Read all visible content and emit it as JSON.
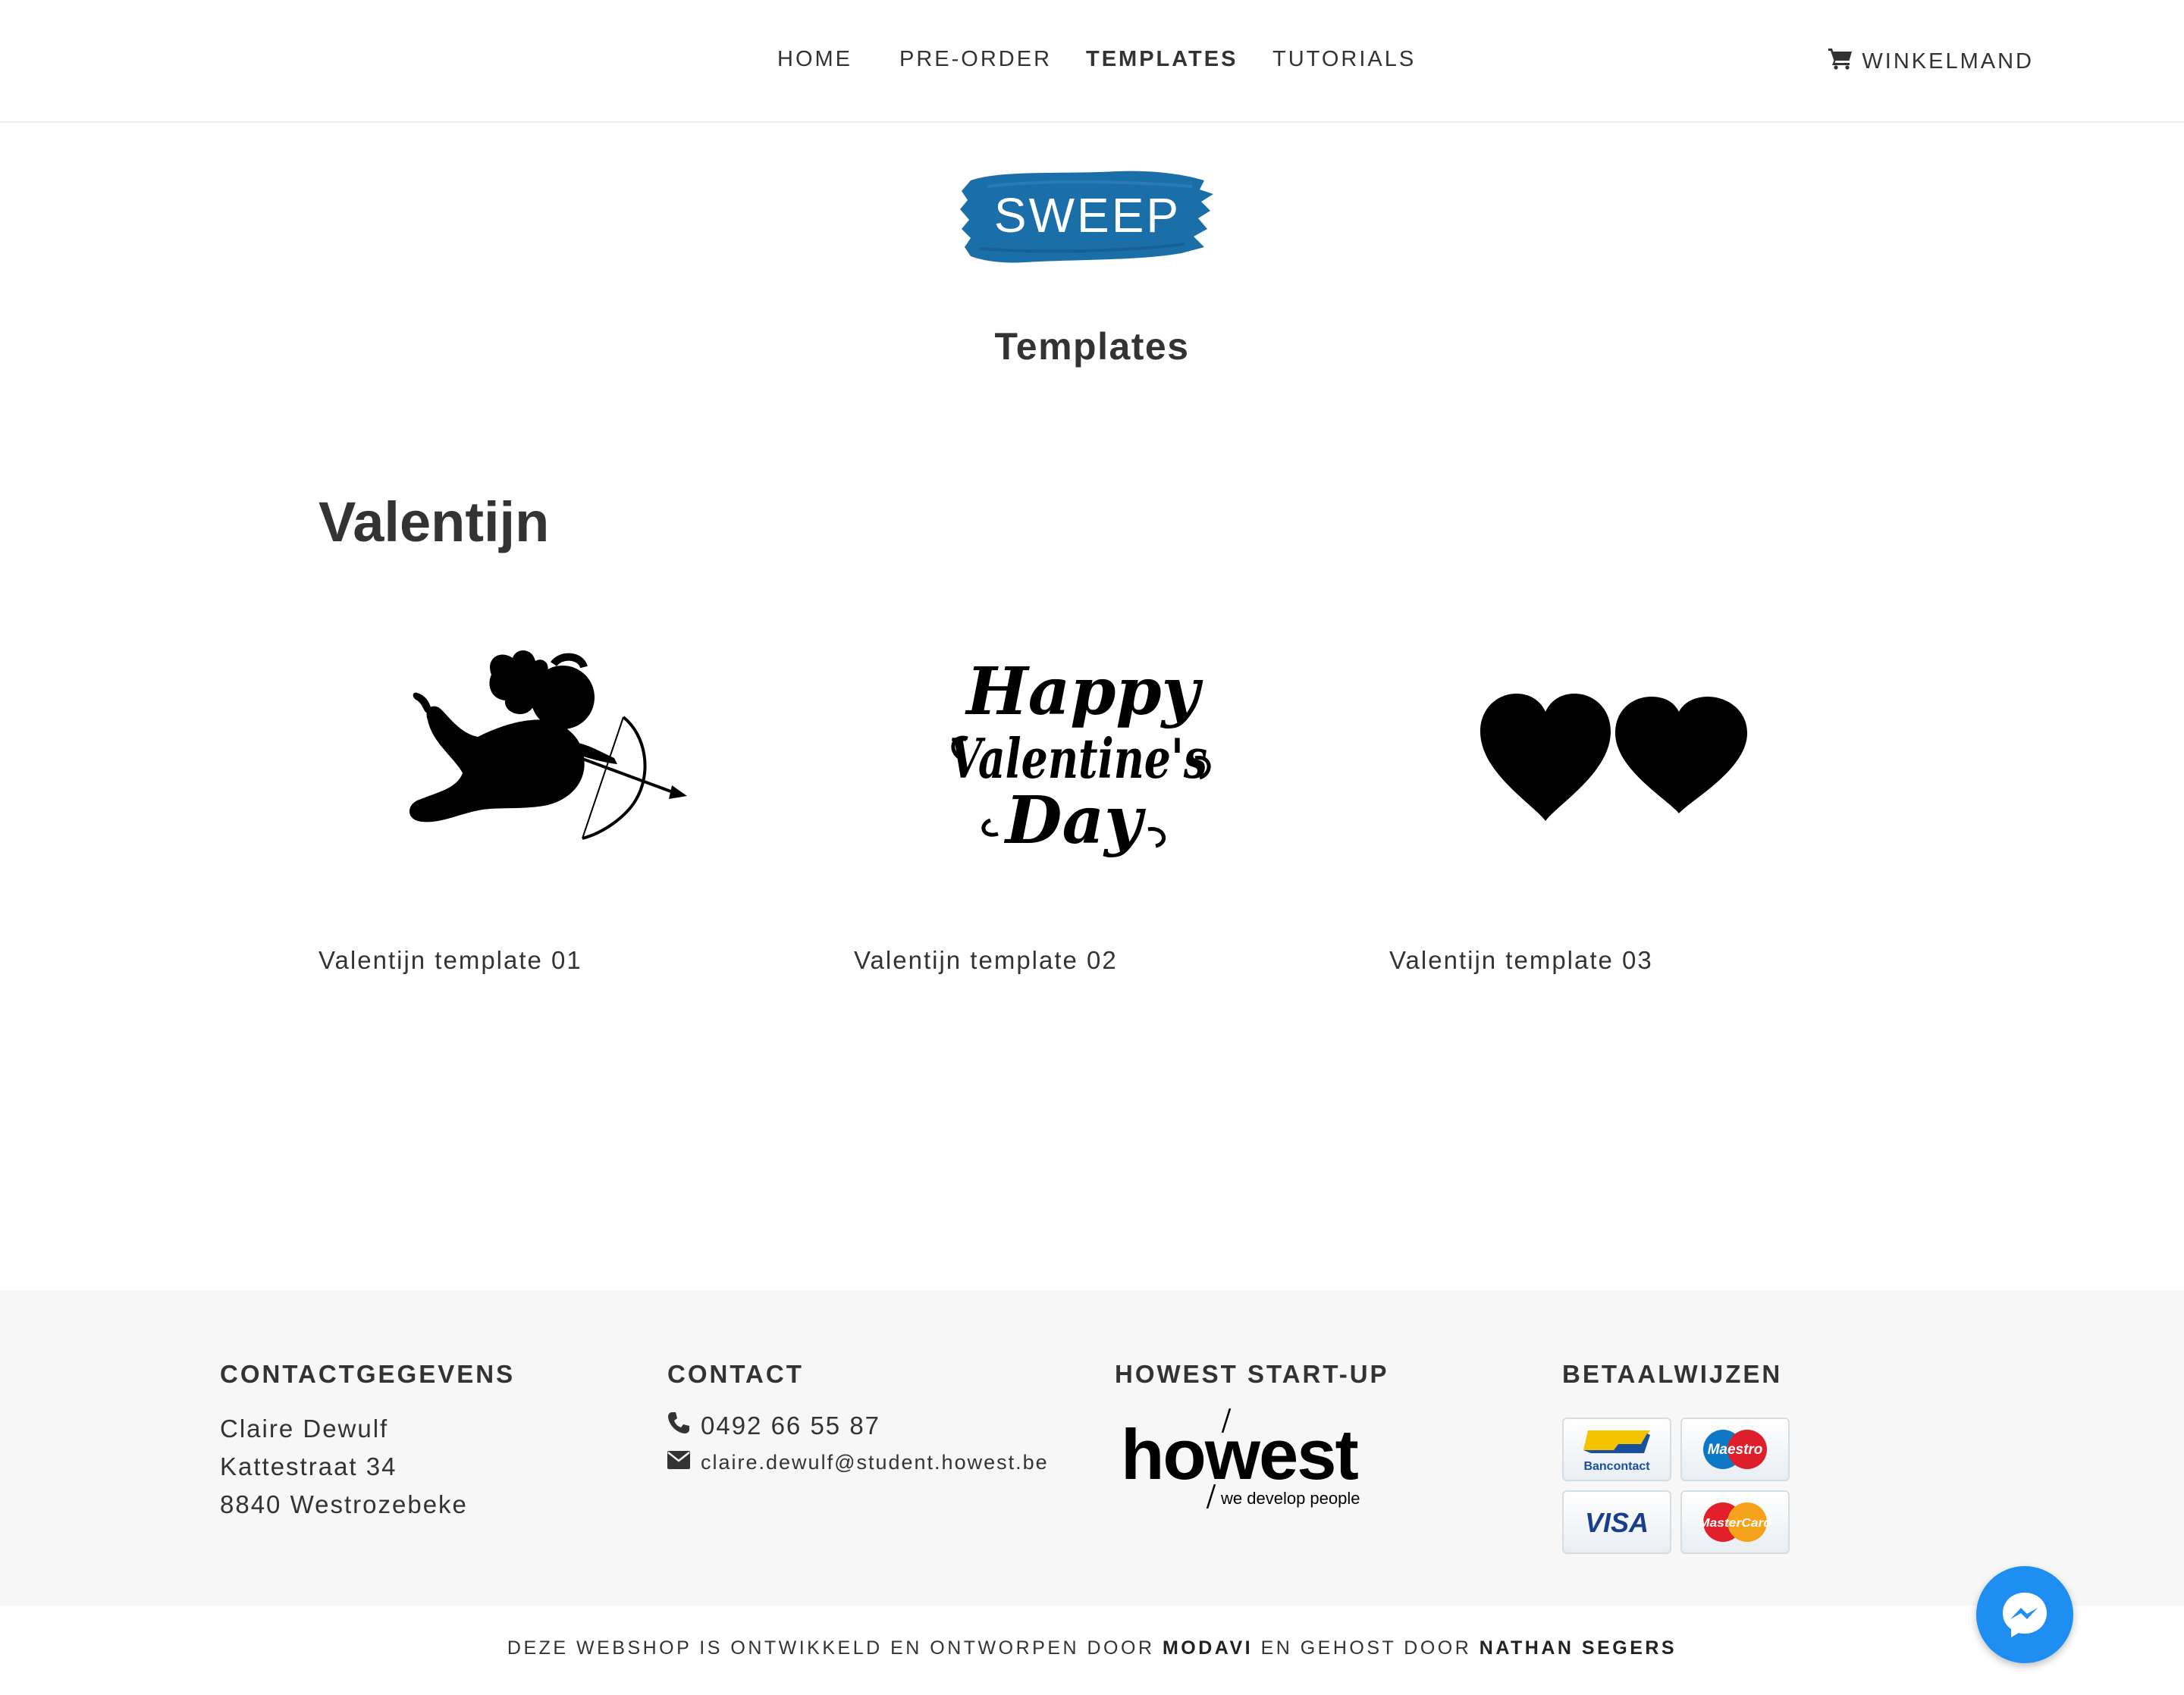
{
  "nav": {
    "items": [
      {
        "label": "HOME",
        "active": false
      },
      {
        "label": "PRE-ORDER",
        "active": false
      },
      {
        "label": "TEMPLATES",
        "active": true
      },
      {
        "label": "TUTORIALS",
        "active": false
      }
    ],
    "cart_label": "WINKELMAND",
    "cart_icon": "shopping-cart-icon"
  },
  "logo": {
    "text": "SWEEP",
    "color": "#1a6fa8"
  },
  "page_title": "Templates",
  "section": {
    "title": "Valentijn",
    "templates": [
      {
        "label": "Valentijn template 01",
        "image": "cupid-silhouette"
      },
      {
        "label": "Valentijn template 02",
        "image": "happy-valentines-day-lettering",
        "lettering": [
          "Happy",
          "Valentine's",
          "Day"
        ]
      },
      {
        "label": "Valentijn template 03",
        "image": "two-hearts"
      }
    ]
  },
  "footer": {
    "contactgegevens": {
      "heading": "CONTACTGEGEVENS",
      "lines": [
        "Claire Dewulf",
        "Kattestraat 34",
        "8840 Westrozebeke"
      ]
    },
    "contact": {
      "heading": "CONTACT",
      "phone": "0492 66 55 87",
      "email": "claire.dewulf@student.howest.be"
    },
    "startup": {
      "heading": "HOWEST START-UP",
      "logo_text": "howest",
      "logo_tagline": "we develop people"
    },
    "betaalwijzen": {
      "heading": "BETAALWIJZEN",
      "methods": [
        "Bancontact",
        "Maestro",
        "VISA",
        "MasterCard"
      ]
    }
  },
  "credits": {
    "prefix": "DEZE WEBSHOP IS ONTWIKKELD EN ONTWORPEN DOOR",
    "developer": "MODAVI",
    "middle": "EN GEHOST DOOR",
    "host": "NATHAN SEGERS"
  },
  "messenger": {
    "icon": "messenger-icon",
    "color": "#1e8ef2"
  }
}
